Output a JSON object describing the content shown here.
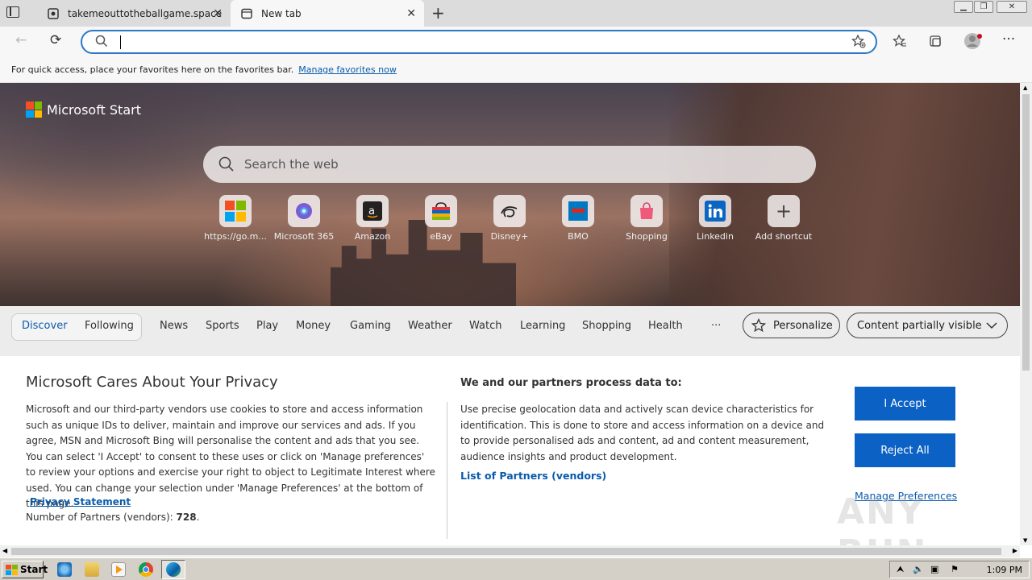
{
  "browser": {
    "tabs": [
      {
        "title": "takemeouttotheballgame.space"
      },
      {
        "title": "New tab"
      }
    ],
    "address_value": "",
    "favorites_bar": {
      "message": "For quick access, place your favorites here on the favorites bar.",
      "link": "Manage favorites now"
    }
  },
  "page": {
    "brand": "Microsoft Start",
    "search_placeholder": "Search the web",
    "shortcuts": [
      {
        "label": "https://go.m...",
        "icon": "microsoft-logo-icon"
      },
      {
        "label": "Microsoft 365",
        "icon": "microsoft365-icon"
      },
      {
        "label": "Amazon",
        "icon": "amazon-icon"
      },
      {
        "label": "eBay",
        "icon": "ebay-icon"
      },
      {
        "label": "Disney+",
        "icon": "disney-icon"
      },
      {
        "label": "BMO",
        "icon": "bmo-icon"
      },
      {
        "label": "Shopping",
        "icon": "shopping-bag-icon"
      },
      {
        "label": "Linkedin",
        "icon": "linkedin-icon"
      },
      {
        "label": "Add shortcut",
        "icon": "plus-icon"
      }
    ],
    "nav": {
      "discover": "Discover",
      "following": "Following",
      "categories": [
        "News",
        "Sports",
        "Play",
        "Money",
        "Gaming",
        "Weather",
        "Watch",
        "Learning",
        "Shopping",
        "Health"
      ],
      "more": "···",
      "personalize": "Personalize",
      "content_visibility": "Content partially visible"
    }
  },
  "privacy": {
    "title": "Microsoft Cares About Your Privacy",
    "body": "Microsoft and our third-party vendors use cookies to store and access information such as unique IDs to deliver, maintain and improve our services and ads. If you agree, MSN and Microsoft Bing will personalise the content and ads that you see. You can select 'I Accept' to consent to these uses or click on 'Manage preferences' to review your options and exercise your right to object to Legitimate Interest where used.  You can change your selection under 'Manage Preferences' at the bottom of this page.",
    "statement_link": "Privacy Statement",
    "statement_dot": ".",
    "partners_label": "Number of Partners (vendors):",
    "partners_count": "728",
    "partners_dot": ".",
    "purposes_title": "We and our partners process data to:",
    "purposes_body": "Use precise geolocation data and actively scan device characteristics for identification. This is done to store and access information on a device and to provide personalised ads and content, ad and content measurement, audience insights and product development.",
    "partners_link": "List of Partners (vendors)",
    "accept": "I Accept",
    "reject": "Reject All",
    "manage": "Manage Preferences"
  },
  "watermark": "ANY RUN",
  "taskbar": {
    "start": "Start",
    "clock": "1:09 PM"
  }
}
